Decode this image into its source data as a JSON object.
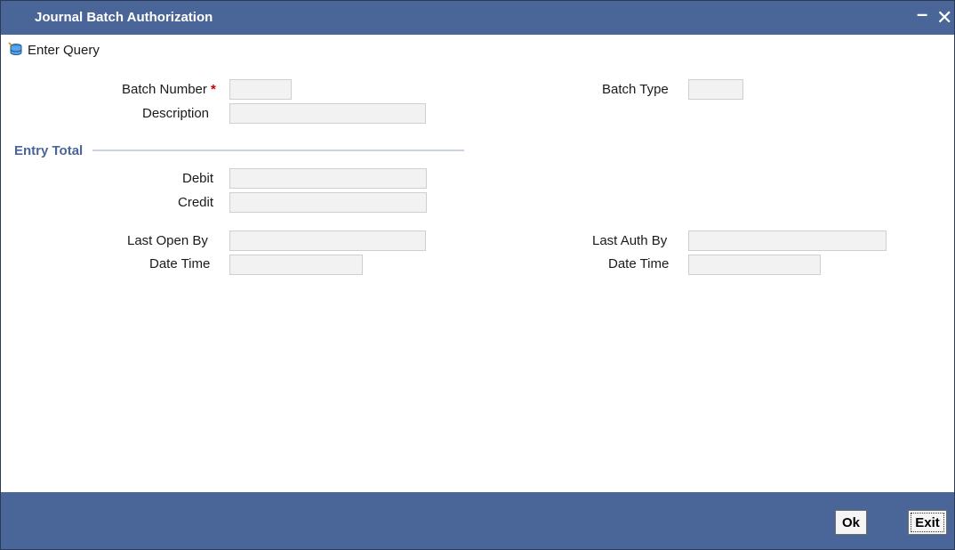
{
  "window": {
    "title": "Journal Batch Authorization",
    "minimize_label": "–",
    "close_label": "✕"
  },
  "toolbar": {
    "enter_query_label": "Enter Query"
  },
  "form": {
    "batch_number": {
      "label": "Batch Number",
      "required_mark": "*",
      "value": ""
    },
    "batch_type": {
      "label": "Batch Type",
      "value": ""
    },
    "description": {
      "label": "Description",
      "value": ""
    },
    "entry_total": {
      "title": "Entry Total",
      "debit": {
        "label": "Debit",
        "value": ""
      },
      "credit": {
        "label": "Credit",
        "value": ""
      }
    },
    "last_open_by": {
      "label": "Last Open By",
      "value": ""
    },
    "last_open_date_time": {
      "label": "Date Time",
      "value": ""
    },
    "last_auth_by": {
      "label": "Last Auth By",
      "value": ""
    },
    "last_auth_date_time": {
      "label": "Date Time",
      "value": ""
    }
  },
  "footer": {
    "ok_label": "Ok",
    "exit_label": "Exit"
  }
}
